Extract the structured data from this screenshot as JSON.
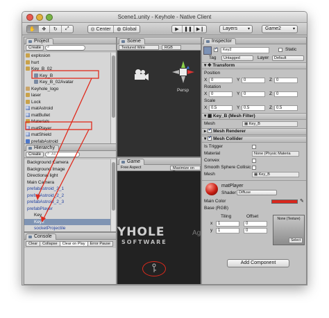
{
  "window": {
    "title": "Scene1.unity - Keyhole - Native Client"
  },
  "toolbar": {
    "tools": [
      "hand-icon",
      "move-icon",
      "rotate-icon",
      "scale-icon"
    ],
    "pivot": "Center",
    "space": "Global",
    "layers": "Layers",
    "layout": "Game2"
  },
  "project": {
    "tab": "Project",
    "create": "Create",
    "items": [
      {
        "label": "explosion",
        "icon": "folder"
      },
      {
        "label": "hurt",
        "icon": "folder"
      },
      {
        "label": "Key_B_02",
        "icon": "folder"
      },
      {
        "label": "Key_B",
        "icon": "mesh",
        "selected_box": true
      },
      {
        "label": "Key_B_02Avatar",
        "icon": "mesh"
      },
      {
        "label": "Keyhole_logo",
        "icon": "texture"
      },
      {
        "label": "laser",
        "icon": "folder"
      },
      {
        "label": "Lock",
        "icon": "folder"
      },
      {
        "label": "matAstroid",
        "icon": "material"
      },
      {
        "label": "matBullet",
        "icon": "material"
      },
      {
        "label": "Materials",
        "icon": "folder"
      },
      {
        "label": "matPlayer",
        "icon": "material",
        "selected_box": true
      },
      {
        "label": "matShield",
        "icon": "material"
      },
      {
        "label": "prefabAstroid",
        "icon": "prefab"
      },
      {
        "label": "prefabAstroid_2",
        "icon": "prefab"
      }
    ]
  },
  "hierarchy": {
    "tab": "Hierarchy",
    "create": "Create",
    "search_placeholder": "All",
    "items": [
      {
        "label": "Background Camera",
        "prefab": false
      },
      {
        "label": "Background Image",
        "prefab": false
      },
      {
        "label": "Directional light",
        "prefab": false
      },
      {
        "label": "Main Camera",
        "prefab": false
      },
      {
        "label": "prefabAstroid_2_1",
        "prefab": true
      },
      {
        "label": "prefabAstroid_2_2",
        "prefab": true
      },
      {
        "label": "prefabAstroid_2_3",
        "prefab": true
      },
      {
        "label": "prefabPlayer",
        "prefab": true
      },
      {
        "label": "Key",
        "prefab": false
      },
      {
        "label": "Key2",
        "prefab": false,
        "selected": true
      },
      {
        "label": "socketProjectile",
        "prefab": true
      }
    ]
  },
  "console": {
    "tab": "Console",
    "buttons": [
      "Clear",
      "Collapse",
      "Clear on Play",
      "Error Pause"
    ]
  },
  "scene": {
    "tab": "Scene",
    "shading": "Textured Wire",
    "mode": "RGB",
    "persp_label": "Persp"
  },
  "game": {
    "tab": "Game",
    "aspect": "Free Aspect",
    "maximize": "Maximize on P",
    "logo_line1": "YHOLE",
    "logo_line2": "SOFTWARE",
    "logo_side": "Agi"
  },
  "inspector": {
    "tab": "Inspector",
    "object_name": "Key2",
    "static_label": "Static",
    "tag_label": "Tag",
    "tag_value": "Untagged",
    "layer_label": "Layer",
    "layer_value": "Default",
    "transform": {
      "header": "Transform",
      "position_label": "Position",
      "rotation_label": "Rotation",
      "scale_label": "Scale",
      "position": [
        "0",
        "0",
        "0"
      ],
      "rotation": [
        "0",
        "0",
        "0"
      ],
      "scale": [
        "0.5",
        "0.5",
        "0.5"
      ]
    },
    "mesh_filter": {
      "header": "Key_B (Mesh Filter)",
      "mesh_label": "Mesh",
      "mesh_value": "Key_B"
    },
    "mesh_renderer": {
      "header": "Mesh Renderer"
    },
    "mesh_collider": {
      "header": "Mesh Collider",
      "is_trigger": "Is Trigger",
      "material": "Material",
      "material_value": "None (Physic Materia",
      "convex": "Convex",
      "smooth": "Smooth Sphere Collisic",
      "mesh_label": "Mesh",
      "mesh_value": "Key_B"
    },
    "material": {
      "name": "matPlayer",
      "shader_label": "Shader",
      "shader_value": "Diffuse",
      "main_color_label": "Main Color",
      "main_color": "#d9271d",
      "base_label": "Base (RGB)",
      "texture_value": "None (Texture)",
      "select_label": "Select",
      "tiling_label": "Tiling",
      "offset_label": "Offset",
      "tiling": [
        "1",
        "1"
      ],
      "offset": [
        "0",
        "0"
      ]
    },
    "add_component": "Add Component"
  }
}
